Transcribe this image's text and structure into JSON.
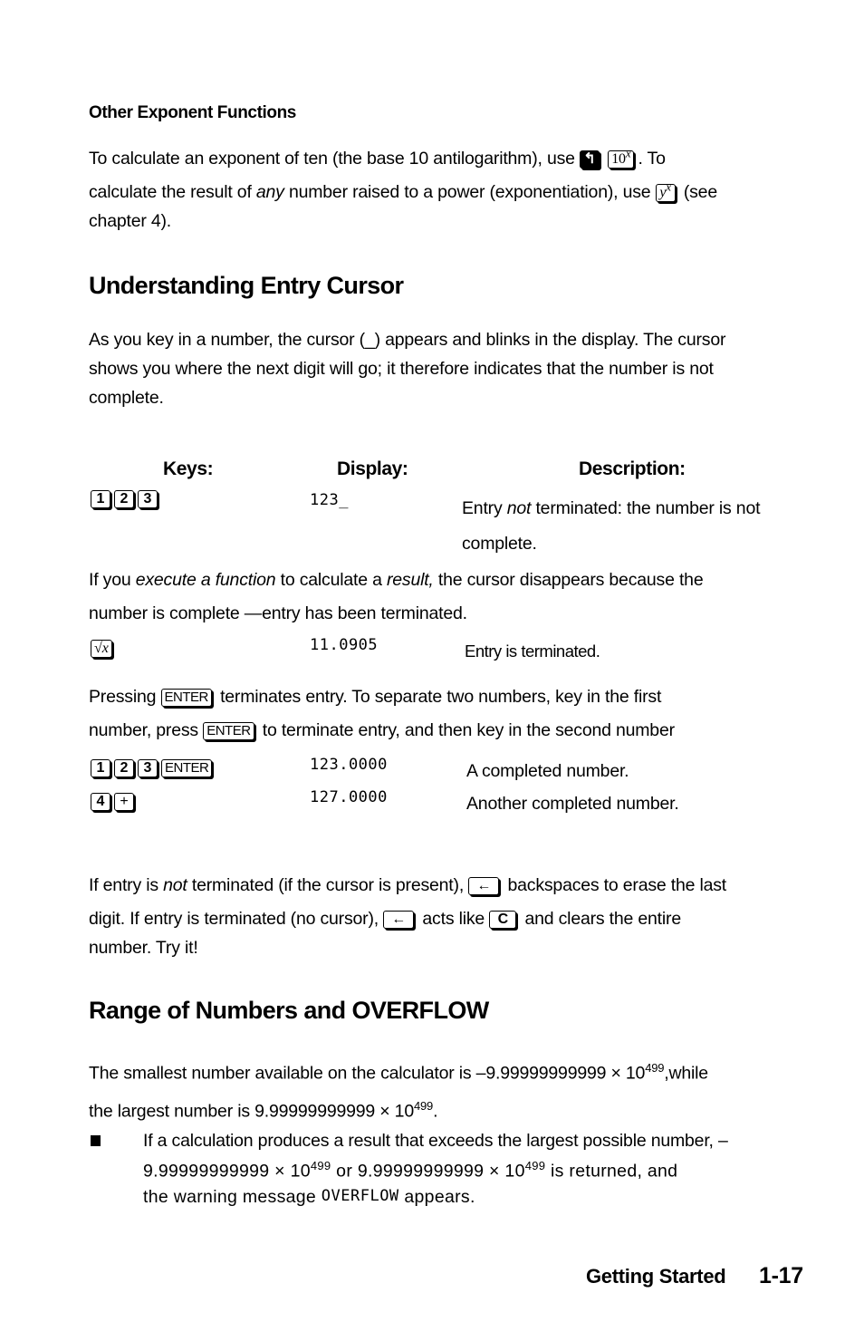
{
  "sections": {
    "other_exponent": {
      "heading": "Other Exponent Functions",
      "p1_a": "To calculate an exponent of ten (the base 10 antilogarithm), use",
      "p1_b": ". To",
      "p1_c": "calculate the result of",
      "p1_c_em": "any",
      "p1_d": "number raised to a power (exponentiation), use",
      "p1_e": "(see",
      "p1_f": "chapter 4).",
      "keys": {
        "shift": "↰",
        "ten_x_base": "10",
        "ten_x_exp": "x",
        "y_x_base": "y",
        "y_x_exp": "x"
      }
    },
    "entry_cursor": {
      "heading": "Understanding Entry Cursor",
      "intro_1": "As you key in a number, the cursor (_) appears and blinks in the display. The cursor",
      "intro_2": "shows you where the next digit will go; it therefore indicates that the number is not",
      "intro_3": "complete.",
      "table": {
        "headers": {
          "keys": "Keys:",
          "display": "Display:",
          "description": "Description:"
        },
        "row1": {
          "keys": [
            "1",
            "2",
            "3"
          ],
          "display": "123_",
          "desc_a": "Entry",
          "desc_em": "not",
          "desc_b": "terminated: the number is not",
          "desc_c": "complete."
        }
      },
      "p2_a": "If you",
      "p2_em1": "execute a function",
      "p2_b": "to calculate a",
      "p2_em2": "result,",
      "p2_c": "the cursor disappears because the",
      "p2_d": "number is complete —entry has been terminated.",
      "row2": {
        "key": "√x",
        "display": "11.0905",
        "desc": "Entry is terminated."
      },
      "p3_a": "Pressing",
      "p3_key": "ENTER",
      "p3_b": "terminates entry. To separate two numbers, key in the first",
      "p3_c": "number, press",
      "p3_d": "to terminate entry, and then key in the second number",
      "row3": {
        "keys": [
          "1",
          "2",
          "3",
          "ENTER"
        ],
        "display": "123.0000",
        "desc": "A completed number."
      },
      "row4": {
        "keys": [
          "4",
          "+"
        ],
        "display": "127.0000",
        "desc": "Another completed number."
      },
      "p4_a": "If entry is",
      "p4_em": "not",
      "p4_b": "terminated (if the cursor is present),",
      "p4_c": "backspaces to erase the last",
      "p4_d": "digit. If entry is terminated (no cursor),",
      "p4_e": "acts like",
      "p4_f": "and clears the entire",
      "p4_g": "number. Try it!",
      "backspace_key": "←",
      "clear_key": "C"
    },
    "range": {
      "heading": "Range of Numbers and OVERFLOW",
      "p1_a": "The smallest number available on the calculator is –9.99999999999 × 10",
      "p1_exp": "499",
      "p1_b": ",while",
      "p1_c": "the largest number is 9.99999999999 × 10",
      "p1_exp2": "499",
      "p1_d": ".",
      "bullet": {
        "line1": "If a calculation produces a result that exceeds the largest possible number, –",
        "line2_a": "9.99999999999 × 10",
        "line2_exp1": "499",
        "line2_b": " or 9.99999999999 × 10",
        "line2_exp2": "499",
        "line2_c": " is returned, and",
        "line3_a": "the warning message",
        "line3_code": "OVERFLOW",
        "line3_b": "appears."
      }
    }
  },
  "footer": {
    "chapter": "Getting Started",
    "page": "1-17"
  }
}
